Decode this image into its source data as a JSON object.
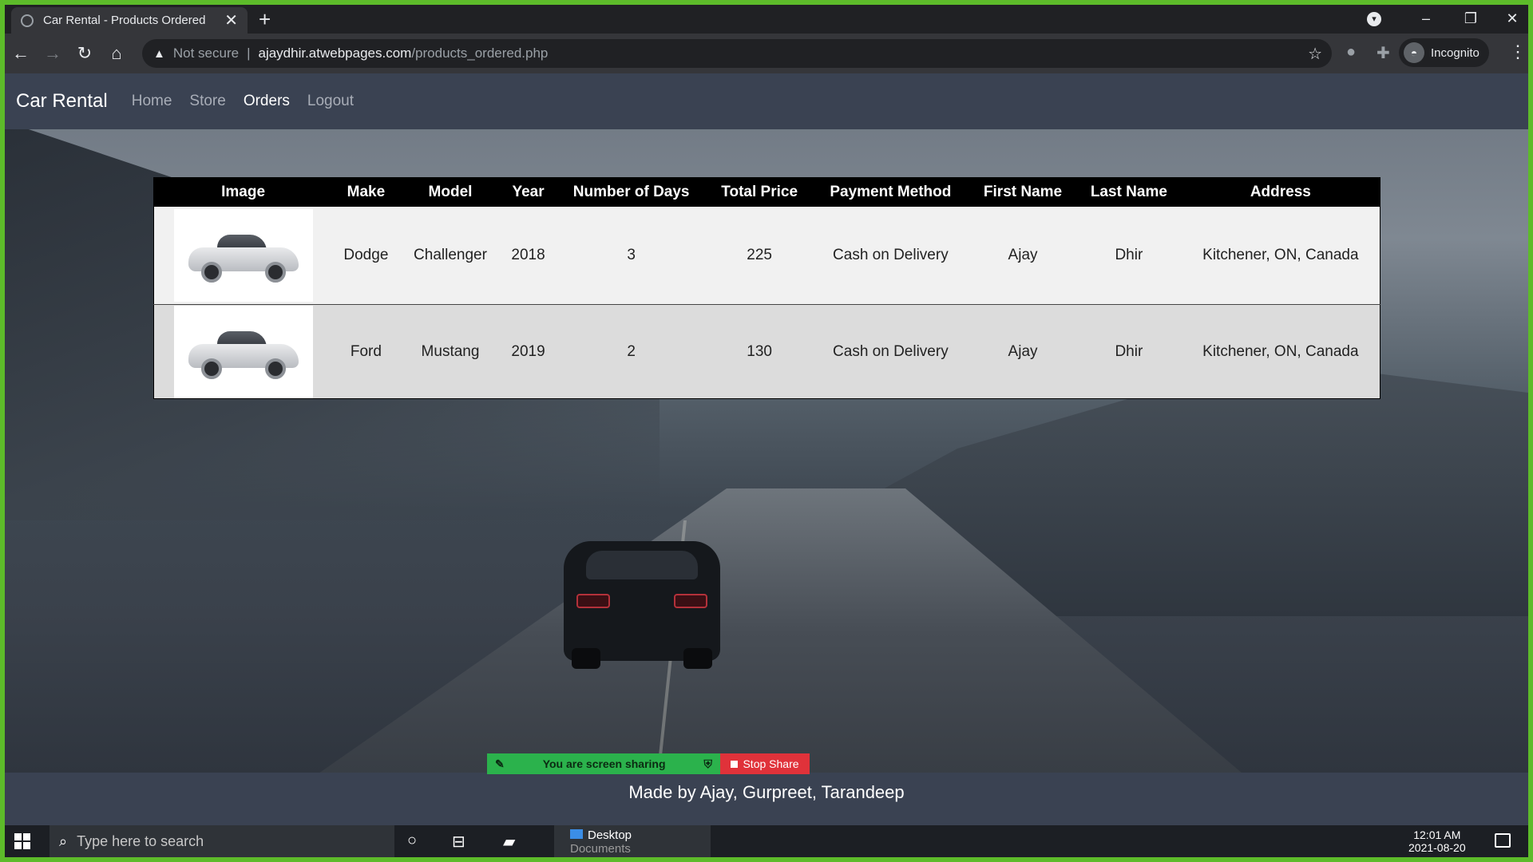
{
  "browser": {
    "tab_title": "Car Rental - Products Ordered",
    "tab_close": "✕",
    "new_tab": "+",
    "security_label": "Not secure",
    "url_host": "ajaydhir.atwebpages.com",
    "url_path": "/products_ordered.php",
    "profile_label": "Incognito"
  },
  "site": {
    "brand": "Car Rental",
    "nav": [
      {
        "label": "Home",
        "active": false
      },
      {
        "label": "Store",
        "active": false
      },
      {
        "label": "Orders",
        "active": true
      },
      {
        "label": "Logout",
        "active": false
      }
    ],
    "footer": "Made by Ajay, Gurpreet, Tarandeep"
  },
  "orders": {
    "headers": [
      "Image",
      "Make",
      "Model",
      "Year",
      "Number of Days",
      "Total Price",
      "Payment Method",
      "First Name",
      "Last Name",
      "Address"
    ],
    "rows": [
      {
        "make": "Dodge",
        "model": "Challenger",
        "year": "2018",
        "days": "3",
        "price": "225",
        "payment": "Cash on Delivery",
        "first": "Ajay",
        "last": "Dhir",
        "address": "Kitchener, ON, Canada",
        "image": "car-photo-dodge-challenger"
      },
      {
        "make": "Ford",
        "model": "Mustang",
        "year": "2019",
        "days": "2",
        "price": "130",
        "payment": "Cash on Delivery",
        "first": "Ajay",
        "last": "Dhir",
        "address": "Kitchener, ON, Canada",
        "image": "car-photo-ford-mustang"
      }
    ]
  },
  "screenshare": {
    "status": "You are screen sharing",
    "stop_label": "Stop Share",
    "status_color": "#2bb24c",
    "stop_color": "#e0323a"
  },
  "taskbar": {
    "search_placeholder": "Type here to search",
    "app_label": "Desktop",
    "app_sub": "Documents",
    "time": "12:01 AM",
    "date": "2021-08-20"
  },
  "colors": {
    "nav_bg": "#3a4252",
    "table_header_bg": "#000000",
    "share_border": "#5dbb2a"
  }
}
